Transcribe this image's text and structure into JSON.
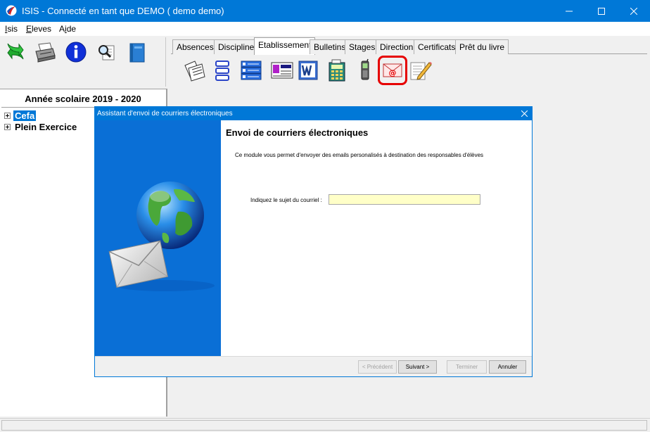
{
  "window": {
    "title": "ISIS - Connecté en tant que DEMO ( demo demo)"
  },
  "menu": [
    {
      "label": "Isis",
      "underline": "I"
    },
    {
      "label": "Eleves",
      "underline": "E"
    },
    {
      "label": "Aide",
      "underline": "i"
    }
  ],
  "toolbar_icons": [
    "refresh-icon",
    "printer-icon",
    "info-icon",
    "search-icon",
    "book-icon"
  ],
  "tabs": [
    "Absences",
    "Discipline",
    "Etablissement",
    "Bulletins",
    "Stages",
    "Direction",
    "Certificats",
    "Prêt du livre"
  ],
  "active_tab": "Etablissement",
  "tab_icons": [
    "documents-icon",
    "list-icon",
    "checklist-icon",
    "isis-card-icon",
    "word-icon",
    "calculator-icon",
    "phone-icon",
    "email-icon",
    "edit-note-icon"
  ],
  "highlight_color": "#e60000",
  "left_panel": {
    "header": "Année scolaire 2019 - 2020",
    "tree": [
      {
        "label": "Cefa",
        "selected": true
      },
      {
        "label": "Plein Exercice",
        "selected": false
      }
    ]
  },
  "dialog": {
    "title": "Assistant d'envoi de courriers électroniques",
    "heading": "Envoi de courriers électroniques",
    "description": "Ce module vous permet d'envoyer des emails personalisés à destination des responsables d'élèves",
    "subject_label": "Indiquez le sujet du courriel :",
    "subject_value": "",
    "buttons": {
      "previous": "< Précédent",
      "next": "Suivant >",
      "finish": "Terminer",
      "cancel": "Annuler"
    }
  },
  "colors": {
    "titlebar": "#0078d7",
    "side_panel": "#0a6fd6",
    "subject_field": "#ffffc8"
  }
}
